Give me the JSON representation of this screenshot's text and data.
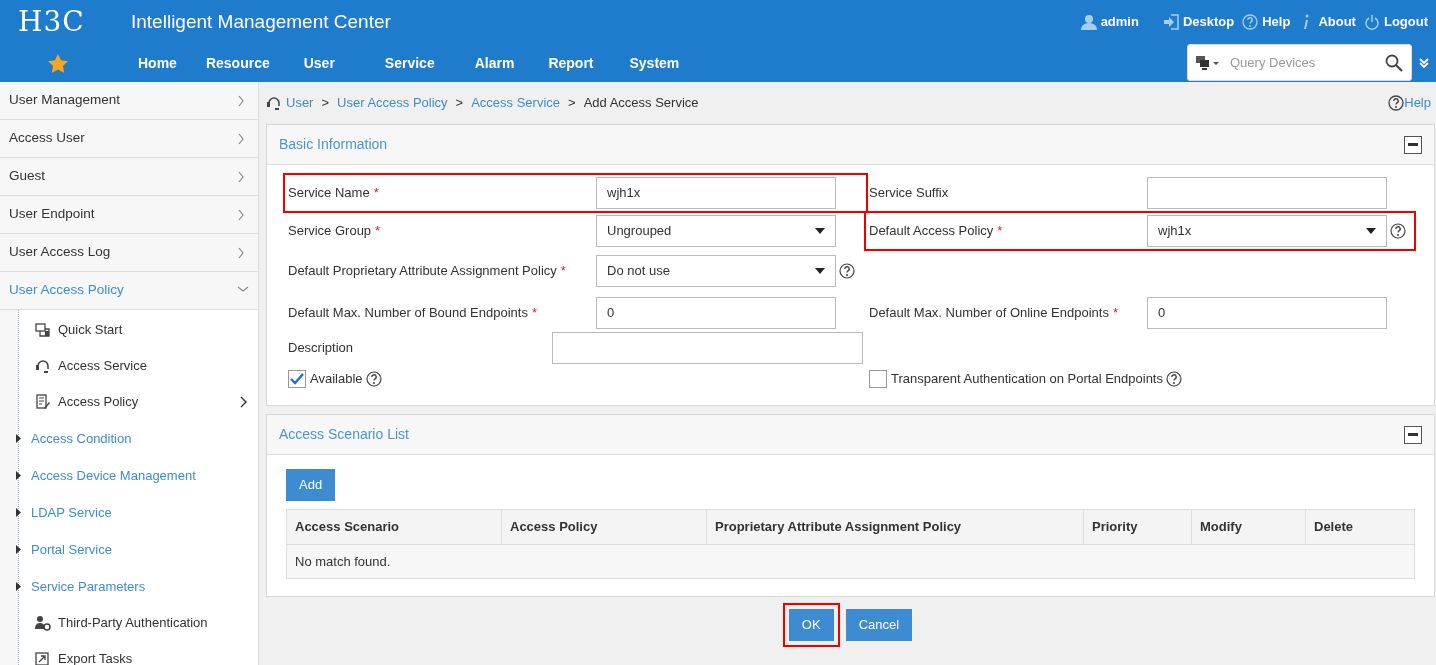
{
  "header": {
    "logo": "H3C",
    "title": "Intelligent Management Center",
    "user_links": [
      {
        "kind": "user",
        "label": "admin"
      },
      {
        "kind": "desktop",
        "label": "Desktop"
      },
      {
        "kind": "help",
        "label": "Help"
      },
      {
        "kind": "about",
        "label": "About"
      },
      {
        "kind": "logout",
        "label": "Logout"
      }
    ],
    "nav": [
      "Home",
      "Resource",
      "User",
      "Service",
      "Alarm",
      "Report",
      "System"
    ],
    "search": {
      "placeholder": "Query Devices"
    }
  },
  "sidebar": {
    "items": [
      {
        "label": "User Management",
        "expanded": false,
        "selected": false
      },
      {
        "label": "Access User",
        "expanded": false,
        "selected": false
      },
      {
        "label": "Guest",
        "expanded": false,
        "selected": false
      },
      {
        "label": "User Endpoint",
        "expanded": false,
        "selected": false
      },
      {
        "label": "User Access Log",
        "expanded": false,
        "selected": false
      },
      {
        "label": "User Access Policy",
        "expanded": true,
        "selected": true,
        "children": [
          {
            "kind": "leaf",
            "label": "Quick Start",
            "has_submenu": false
          },
          {
            "kind": "leaf",
            "label": "Access Service",
            "has_submenu": false
          },
          {
            "kind": "leaf",
            "label": "Access Policy",
            "has_submenu": true
          },
          {
            "kind": "group",
            "label": "Access Condition",
            "expanded": false
          },
          {
            "kind": "group",
            "label": "Access Device Management",
            "expanded": false
          },
          {
            "kind": "group",
            "label": "LDAP Service",
            "expanded": false
          },
          {
            "kind": "group",
            "label": "Portal Service",
            "expanded": false
          },
          {
            "kind": "group",
            "label": "Service Parameters",
            "expanded": false
          },
          {
            "kind": "leaf",
            "label": "Third-Party Authentication",
            "has_submenu": false
          },
          {
            "kind": "leaf",
            "label": "Export Tasks",
            "has_submenu": false
          }
        ]
      }
    ]
  },
  "breadcrumb": {
    "links": [
      "User",
      "User Access Policy",
      "Access Service"
    ],
    "separator": ">",
    "current": "Add Access Service",
    "help": "Help"
  },
  "basic_information": {
    "title": "Basic Information",
    "rows": [
      [
        {
          "kind": "text",
          "label": "Service Name",
          "required_mark": "*",
          "value": "wjh1x",
          "help": false,
          "highlighted": true
        },
        {
          "kind": "text",
          "label": "Service Suffix",
          "help": false,
          "highlighted": false
        }
      ],
      [
        {
          "kind": "select",
          "label": "Service Group",
          "required_mark": "*",
          "value": "Ungrouped",
          "help": false,
          "highlighted": false
        },
        {
          "kind": "select",
          "label": "Default Access Policy",
          "required_mark": "*",
          "value": "wjh1x",
          "help": true,
          "highlighted": true
        }
      ],
      [
        {
          "kind": "select",
          "label": "Default Proprietary Attribute Assignment Policy",
          "required_mark": "*",
          "value": "Do not use",
          "help": true,
          "highlighted": false
        }
      ],
      [
        {
          "kind": "text",
          "label": "Default Max. Number of Bound Endpoints",
          "required_mark": "*",
          "value": "0",
          "help": false,
          "highlighted": false
        },
        {
          "kind": "text",
          "label": "Default Max. Number of Online Endpoints",
          "required_mark": "*",
          "value": "0",
          "help": false,
          "highlighted": false
        }
      ],
      [
        {
          "kind": "wide",
          "label": "Description",
          "help": false,
          "highlighted": false
        }
      ],
      [
        {
          "kind": "checkbox",
          "label": "Available",
          "checked": true,
          "help": true,
          "highlighted": false
        },
        {
          "kind": "checkbox",
          "label": "Transparent Authentication on Portal Endpoints",
          "checked": false,
          "help": true,
          "highlighted": false
        }
      ]
    ]
  },
  "access_scenario_list": {
    "title": "Access Scenario List",
    "add_button": "Add",
    "table": {
      "columns": [
        "Access Scenario",
        "Access Policy",
        "Proprietary Attribute Assignment Policy",
        "Priority",
        "Modify",
        "Delete"
      ],
      "empty_text": "No match found."
    }
  },
  "buttons": [
    {
      "label": "OK",
      "highlighted": true
    },
    {
      "label": "Cancel",
      "highlighted": false
    }
  ]
}
